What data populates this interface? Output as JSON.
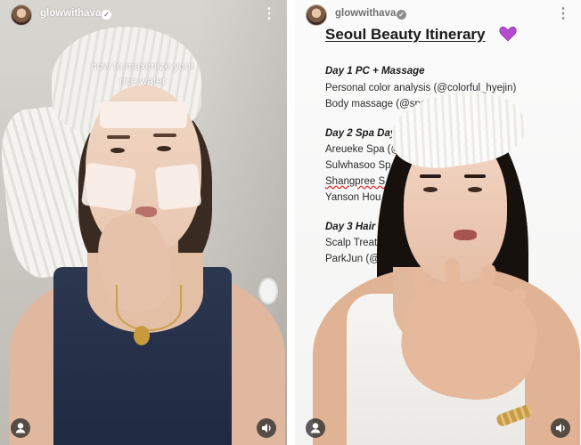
{
  "left_post": {
    "username": "glowwithava",
    "caption_lines": [
      "how to maximize your",
      "rice water"
    ]
  },
  "right_post": {
    "username": "glowwithava",
    "title": "Seoul Beauty Itinerary",
    "itinerary": [
      {
        "type": "head",
        "text": "Day 1 PC + Massage"
      },
      {
        "type": "item",
        "text": "Personal color analysis (@colorful_hyejin)"
      },
      {
        "type": "item",
        "text": "Body massage (@spa"
      },
      {
        "type": "head",
        "text": "Day 2 Spa Day"
      },
      {
        "type": "item",
        "text": "Areueke Spa (@"
      },
      {
        "type": "item",
        "text": "Sulwhasoo Sp"
      },
      {
        "type": "item",
        "text": "Shangpree S"
      },
      {
        "type": "item",
        "text": "Yanson Hou"
      },
      {
        "type": "head",
        "text": "Day 3 Hair"
      },
      {
        "type": "item",
        "text": "Scalp Treat"
      },
      {
        "type": "item",
        "text": "ParkJun (@"
      }
    ]
  },
  "icons": {
    "verified": "verified-check-icon",
    "more": "more-vertical-icon",
    "profile": "user-icon",
    "sound": "speaker-icon",
    "heart": "purple-heart-icon"
  },
  "colors": {
    "verified_badge": "#ffffff",
    "heart": "#b44bd1",
    "title_text": "#1a1a1a",
    "spellcheck": "#e02020"
  }
}
